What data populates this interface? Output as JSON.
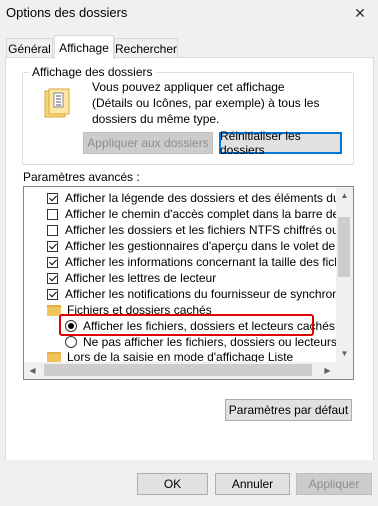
{
  "window": {
    "title": "Options des dossiers",
    "close_glyph": "✕"
  },
  "tabs": [
    {
      "label": "Général",
      "active": false
    },
    {
      "label": "Affichage",
      "active": true
    },
    {
      "label": "Rechercher",
      "active": false
    }
  ],
  "folder_view": {
    "group_label": "Affichage des dossiers",
    "description": "Vous pouvez appliquer cet affichage (Détails ou Icônes, par exemple) à tous les dossiers du même type.",
    "apply_button": "Appliquer aux dossiers",
    "reset_button": "Réinitialiser les dossiers"
  },
  "advanced": {
    "label": "Paramètres avancés :",
    "items": [
      {
        "kind": "checkbox",
        "checked": true,
        "label": "Afficher la légende des dossiers et des éléments du Burea"
      },
      {
        "kind": "checkbox",
        "checked": false,
        "label": "Afficher le chemin d'accès complet dans la barre de titre"
      },
      {
        "kind": "checkbox",
        "checked": false,
        "label": "Afficher les dossiers et les fichiers NTFS chiffrés ou compr"
      },
      {
        "kind": "checkbox",
        "checked": true,
        "label": "Afficher les gestionnaires d'aperçu dans le volet de visual"
      },
      {
        "kind": "checkbox",
        "checked": true,
        "label": "Afficher les informations concernant la taille des fichiers d"
      },
      {
        "kind": "checkbox",
        "checked": true,
        "label": "Afficher les lettres de lecteur"
      },
      {
        "kind": "checkbox",
        "checked": true,
        "label": "Afficher les notifications du fournisseur de synchronisation"
      },
      {
        "kind": "folder",
        "label": "Fichiers et dossiers cachés"
      },
      {
        "kind": "radio",
        "checked": true,
        "label": "Afficher les fichiers, dossiers et lecteurs cachés"
      },
      {
        "kind": "radio",
        "checked": false,
        "label": "Ne pas afficher les fichiers, dossiers ou lecteurs cach"
      },
      {
        "kind": "folder",
        "label": "Lors de la saisie en mode d'affichage Liste"
      }
    ],
    "defaults_button": "Paramètres par défaut"
  },
  "footer": {
    "ok": "OK",
    "cancel": "Annuler",
    "apply": "Appliquer"
  },
  "colors": {
    "highlight": "#e00000",
    "focus": "#0078d7",
    "folder": "#f2c55c"
  }
}
